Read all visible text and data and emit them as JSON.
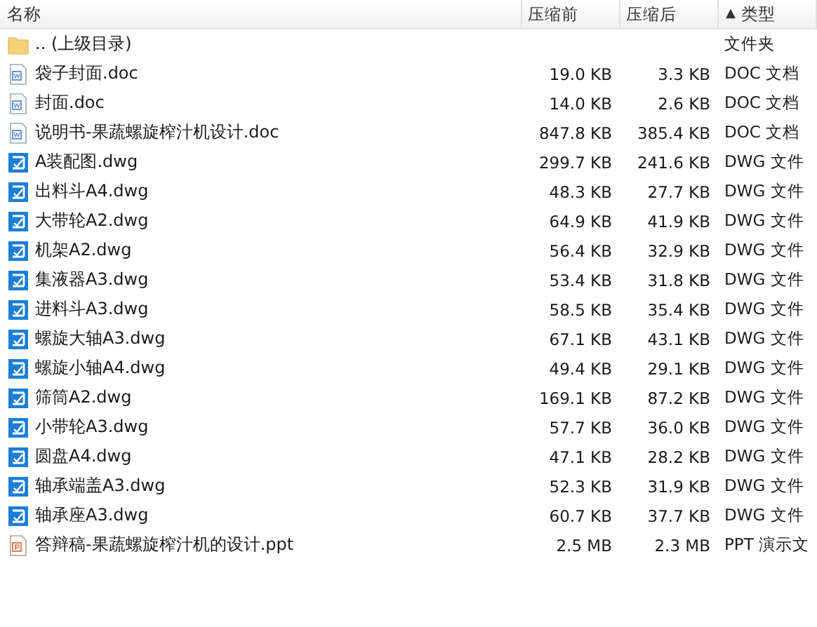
{
  "columns": [
    {
      "label": "名称"
    },
    {
      "label": "压缩前"
    },
    {
      "label": "压缩后"
    },
    {
      "label": "类型",
      "sort_indicator": "▲"
    }
  ],
  "rows": [
    {
      "kind": "folder",
      "name": ".. (上级目录)",
      "size": "",
      "packed": "",
      "type": "文件夹"
    },
    {
      "kind": "doc",
      "name": "袋子封面.doc",
      "size": "19.0 KB",
      "packed": "3.3 KB",
      "type": "DOC 文档"
    },
    {
      "kind": "doc",
      "name": "封面.doc",
      "size": "14.0 KB",
      "packed": "2.6 KB",
      "type": "DOC 文档"
    },
    {
      "kind": "doc",
      "name": "说明书-果蔬螺旋榨汁机设计.doc",
      "size": "847.8 KB",
      "packed": "385.4 KB",
      "type": "DOC 文档"
    },
    {
      "kind": "dwg",
      "name": "A装配图.dwg",
      "size": "299.7 KB",
      "packed": "241.6 KB",
      "type": "DWG 文件"
    },
    {
      "kind": "dwg",
      "name": "出料斗A4.dwg",
      "size": "48.3 KB",
      "packed": "27.7 KB",
      "type": "DWG 文件"
    },
    {
      "kind": "dwg",
      "name": "大带轮A2.dwg",
      "size": "64.9 KB",
      "packed": "41.9 KB",
      "type": "DWG 文件"
    },
    {
      "kind": "dwg",
      "name": "机架A2.dwg",
      "size": "56.4 KB",
      "packed": "32.9 KB",
      "type": "DWG 文件"
    },
    {
      "kind": "dwg",
      "name": "集液器A3.dwg",
      "size": "53.4 KB",
      "packed": "31.8 KB",
      "type": "DWG 文件"
    },
    {
      "kind": "dwg",
      "name": "进料斗A3.dwg",
      "size": "58.5 KB",
      "packed": "35.4 KB",
      "type": "DWG 文件"
    },
    {
      "kind": "dwg",
      "name": "螺旋大轴A3.dwg",
      "size": "67.1 KB",
      "packed": "43.1 KB",
      "type": "DWG 文件"
    },
    {
      "kind": "dwg",
      "name": "螺旋小轴A4.dwg",
      "size": "49.4 KB",
      "packed": "29.1 KB",
      "type": "DWG 文件"
    },
    {
      "kind": "dwg",
      "name": "筛筒A2.dwg",
      "size": "169.1 KB",
      "packed": "87.2 KB",
      "type": "DWG 文件"
    },
    {
      "kind": "dwg",
      "name": "小带轮A3.dwg",
      "size": "57.7 KB",
      "packed": "36.0 KB",
      "type": "DWG 文件"
    },
    {
      "kind": "dwg",
      "name": "圆盘A4.dwg",
      "size": "47.1 KB",
      "packed": "28.2 KB",
      "type": "DWG 文件"
    },
    {
      "kind": "dwg",
      "name": "轴承端盖A3.dwg",
      "size": "52.3 KB",
      "packed": "31.9 KB",
      "type": "DWG 文件"
    },
    {
      "kind": "dwg",
      "name": "轴承座A3.dwg",
      "size": "60.7 KB",
      "packed": "37.7 KB",
      "type": "DWG 文件"
    },
    {
      "kind": "ppt",
      "name": "答辩稿-果蔬螺旋榨汁机的设计.ppt",
      "size": "2.5 MB",
      "packed": "2.3 MB",
      "type": "PPT 演示文"
    }
  ]
}
